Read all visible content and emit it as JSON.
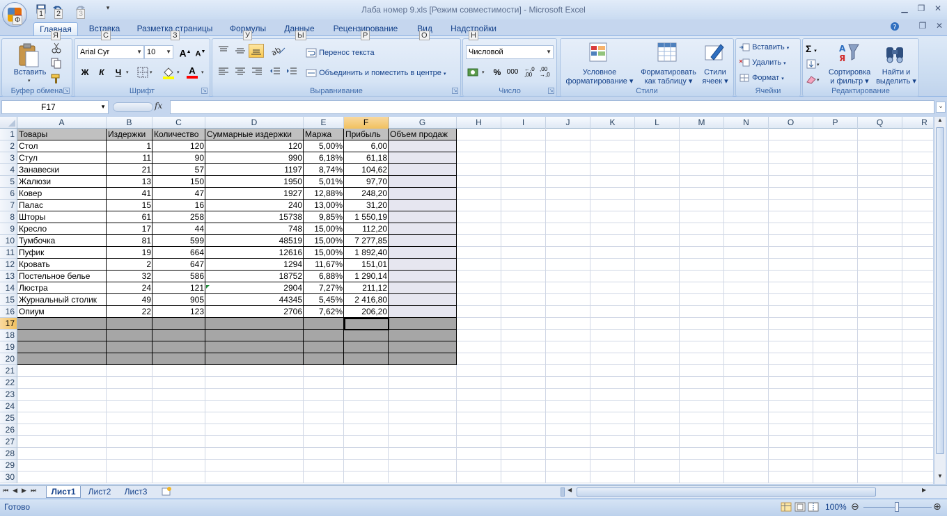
{
  "window": {
    "title": "Лаба номер 9.xls  [Режим совместимости] - Microsoft Excel",
    "qat_hints": [
      "1",
      "2",
      "3"
    ]
  },
  "tabs": [
    {
      "label": "Главная",
      "hint": "Я",
      "active": true
    },
    {
      "label": "Вставка",
      "hint": "С"
    },
    {
      "label": "Разметка страницы",
      "hint": "З"
    },
    {
      "label": "Формулы",
      "hint": "У"
    },
    {
      "label": "Данные",
      "hint": "Ы"
    },
    {
      "label": "Рецензирование",
      "hint": "Р"
    },
    {
      "label": "Вид",
      "hint": "О"
    },
    {
      "label": "Надстройки",
      "hint": "Н"
    }
  ],
  "ribbon": {
    "clipboard": {
      "label": "Буфер обмена",
      "paste": "Вставить"
    },
    "font": {
      "label": "Шрифт",
      "font_name": "Arial Cyr",
      "font_size": "10",
      "bold": "Ж",
      "italic": "К",
      "underline": "Ч",
      "grow": "A",
      "shrink": "A",
      "font_color_letter": "A"
    },
    "alignment": {
      "label": "Выравнивание",
      "wrap": "Перенос текста",
      "merge": "Объединить и поместить в центре"
    },
    "number": {
      "label": "Число",
      "format": "Числовой",
      "percent": "%",
      "thousands": "000",
      "inc_dec": ",0 ,00",
      "dec_dec": ",00 ,0"
    },
    "styles": {
      "label": "Стили",
      "conditional_1": "Условное",
      "conditional_2": "форматирование",
      "table_1": "Форматировать",
      "table_2": "как таблицу",
      "cell_styles_1": "Стили",
      "cell_styles_2": "ячеек"
    },
    "cells": {
      "label": "Ячейки",
      "insert": "Вставить",
      "delete": "Удалить",
      "format": "Формат"
    },
    "editing": {
      "label": "Редактирование",
      "sort_1": "Сортировка",
      "sort_2": "и фильтр",
      "find_1": "Найти и",
      "find_2": "выделить"
    }
  },
  "formula_bar": {
    "name_box": "F17",
    "fx": "fx",
    "formula": ""
  },
  "columns": [
    "A",
    "B",
    "C",
    "D",
    "E",
    "F",
    "G",
    "H",
    "I",
    "J",
    "K",
    "L",
    "M",
    "N",
    "O",
    "P",
    "Q",
    "R"
  ],
  "rows": [
    "1",
    "2",
    "3",
    "4",
    "5",
    "6",
    "7",
    "8",
    "9",
    "10",
    "11",
    "12",
    "13",
    "14",
    "15",
    "16",
    "17",
    "18",
    "19",
    "20",
    "21",
    "22",
    "23",
    "24",
    "25",
    "26",
    "27",
    "28",
    "29",
    "30"
  ],
  "headers": [
    "Товары",
    "Издержки",
    "Количество",
    "Суммарные издержки",
    "Маржа",
    "Прибыль",
    "Объем продаж"
  ],
  "table": [
    [
      "Стол",
      "1",
      "120",
      "120",
      "5,00%",
      "6,00"
    ],
    [
      "Стул",
      "11",
      "90",
      "990",
      "6,18%",
      "61,18"
    ],
    [
      "Занавески",
      "21",
      "57",
      "1197",
      "8,74%",
      "104,62"
    ],
    [
      "Жалюзи",
      "13",
      "150",
      "1950",
      "5,01%",
      "97,70"
    ],
    [
      "Ковер",
      "41",
      "47",
      "1927",
      "12,88%",
      "248,20"
    ],
    [
      "Палас",
      "15",
      "16",
      "240",
      "13,00%",
      "31,20"
    ],
    [
      "Шторы",
      "61",
      "258",
      "15738",
      "9,85%",
      "1 550,19"
    ],
    [
      "Кресло",
      "17",
      "44",
      "748",
      "15,00%",
      "112,20"
    ],
    [
      "Тумбочка",
      "81",
      "599",
      "48519",
      "15,00%",
      "7 277,85"
    ],
    [
      "Пуфик",
      "19",
      "664",
      "12616",
      "15,00%",
      "1 892,40"
    ],
    [
      "Кровать",
      "2",
      "647",
      "1294",
      "11,67%",
      "151,01"
    ],
    [
      "Постельное белье",
      "32",
      "586",
      "18752",
      "6,88%",
      "1 290,14"
    ],
    [
      "Люстра",
      "24",
      "121",
      "2904",
      "7,27%",
      "211,12"
    ],
    [
      "Журнальный столик",
      "49",
      "905",
      "44345",
      "5,45%",
      "2 416,80"
    ],
    [
      "Опиум",
      "22",
      "123",
      "2706",
      "7,62%",
      "206,20"
    ]
  ],
  "sheets": [
    "Лист1",
    "Лист2",
    "Лист3"
  ],
  "status": {
    "ready": "Готово",
    "zoom": "100%"
  },
  "colors": {
    "header_fill": "#c0c0c0",
    "gray_fill": "#a6a6a6",
    "volume_fill": "#e6e6f0",
    "selection_header": "#f5c56a"
  }
}
